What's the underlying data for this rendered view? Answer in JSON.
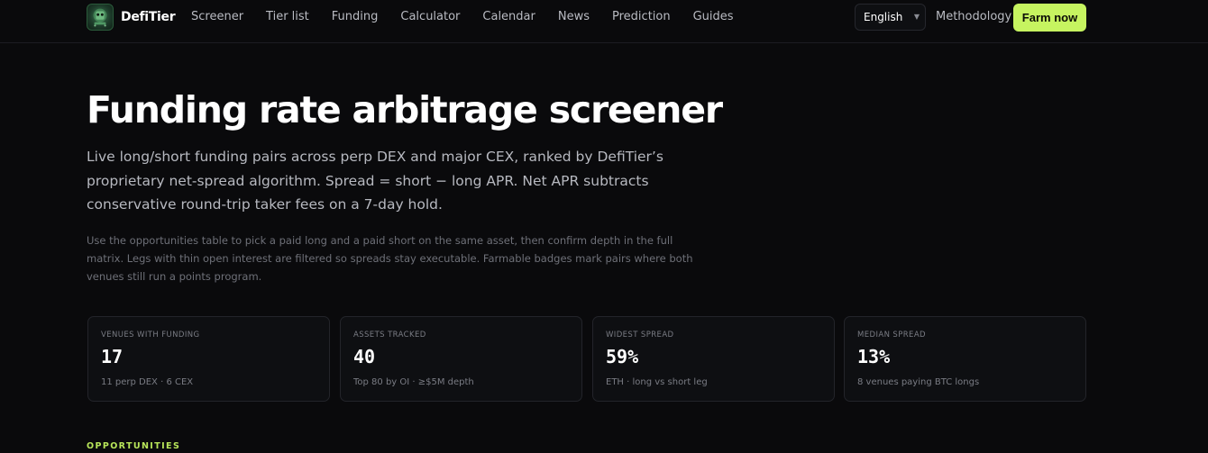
{
  "header": {
    "brand": "DefiTier",
    "nav": [
      "Screener",
      "Tier list",
      "Funding",
      "Calculator",
      "Calendar",
      "News",
      "Prediction",
      "Guides"
    ],
    "language": "English",
    "methodology": "Methodology",
    "cta": "Farm now"
  },
  "hero": {
    "title": "Funding rate arbitrage screener",
    "lede": "Live long/short funding pairs across perp DEX and major CEX, ranked by DefiTier’s proprietary net-spread algorithm. Spread = short − long APR. Net APR subtracts conservative round-trip taker fees on a 7-day hold.",
    "note": "Use the opportunities table to pick a paid long and a paid short on the same asset, then confirm depth in the full matrix. Legs with thin open interest are filtered so spreads stay executable. Farmable badges mark pairs where both venues still run a points program."
  },
  "stats": [
    {
      "label": "Venues with funding",
      "value": "17",
      "sub": "11 perp DEX · 6 CEX"
    },
    {
      "label": "Assets tracked",
      "value": "40",
      "sub": "Top 80 by OI · ≥$5M depth"
    },
    {
      "label": "Widest spread",
      "value": "59%",
      "sub": "ETH · long vs short leg"
    },
    {
      "label": "Median spread",
      "value": "13%",
      "sub": "8 venues paying BTC longs"
    }
  ],
  "section": {
    "label": "OPPORTUNITIES"
  },
  "colors": {
    "accent": "#c6f460",
    "background": "#0a0a0c",
    "card": "#0e0f12",
    "border": "#23242a"
  }
}
